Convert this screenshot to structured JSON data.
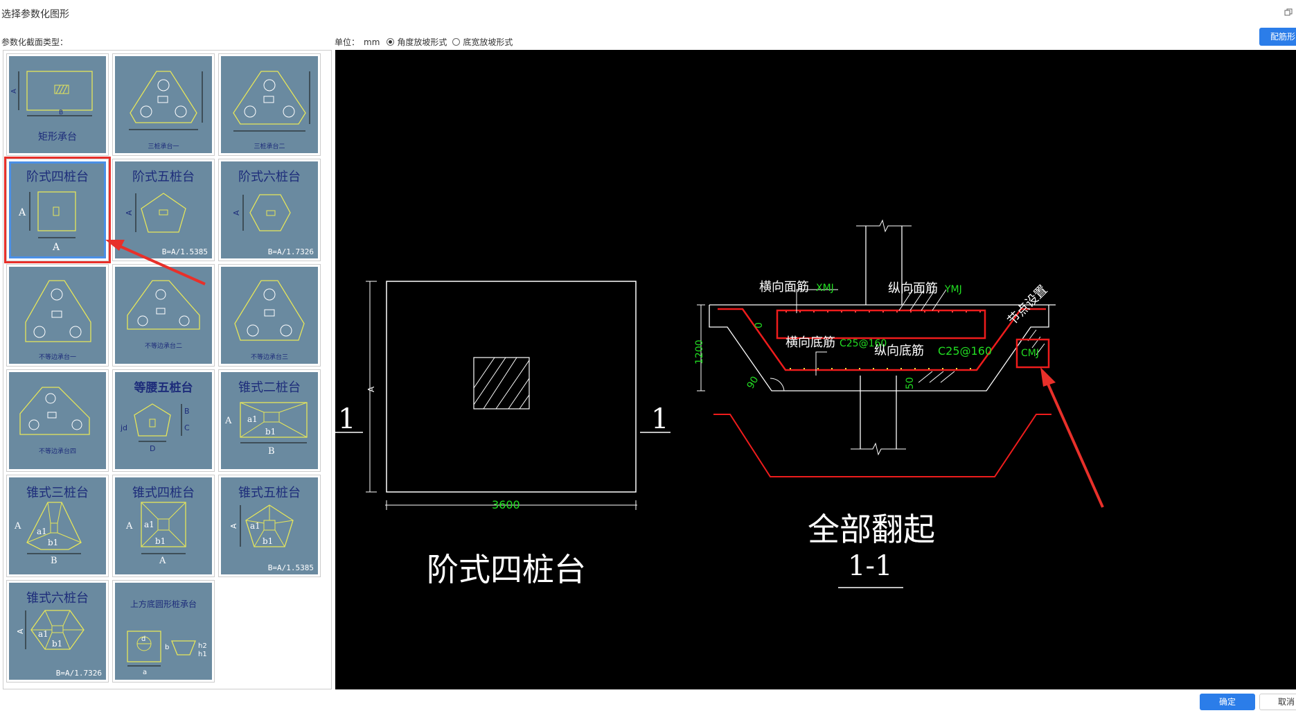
{
  "window": {
    "title": "选择参数化图形"
  },
  "toolbar": {
    "section_label": "参数化截面类型：",
    "unit_label": "单位：",
    "unit_value": "mm",
    "radio_angle": "角度放坡形式",
    "radio_width": "底宽放坡形式",
    "selected_radio": "angle",
    "rebar_button": "配筋形"
  },
  "tiles": [
    {
      "title": "矩形承台"
    },
    {
      "title": "三桩承台一"
    },
    {
      "title": "三桩承台二"
    },
    {
      "title": "阶式四桩台",
      "selected": true
    },
    {
      "title": "阶式五桩台",
      "formula": "B=A/1.5385"
    },
    {
      "title": "阶式六桩台",
      "formula": "B=A/1.7326"
    },
    {
      "title": "不等边承台一"
    },
    {
      "title": "不等边承台二"
    },
    {
      "title": "不等边承台三"
    },
    {
      "title": "不等边承台四"
    },
    {
      "title": "等腰五桩台"
    },
    {
      "title": "锥式二桩台"
    },
    {
      "title": "锥式三桩台"
    },
    {
      "title": "锥式四桩台"
    },
    {
      "title": "锥式五桩台",
      "formula": "B=A/1.5385"
    },
    {
      "title": "锥式六桩台",
      "formula": "B=A/1.7326"
    },
    {
      "title": "上方底圆形桩承台"
    }
  ],
  "tile_labels": {
    "A": "A",
    "B": "B",
    "C": "C",
    "D": "D",
    "a1": "a1",
    "b1": "b1",
    "jd": "jd",
    "d": "d",
    "b": "b",
    "a": "a",
    "h1": "h1",
    "h2": "h2"
  },
  "canvas": {
    "plan_title": "阶式四桩台",
    "dim_width": "3600",
    "section_mark": "1",
    "section_title": "全部翻起",
    "section_id": "1-1",
    "label_hor_top": "横向面筋",
    "label_hor_top_code": "XMJ",
    "label_long_top": "纵向面筋",
    "label_long_top_code": "YMJ",
    "label_hor_bot": "横向底筋",
    "label_hor_bot_code": "C25@160",
    "label_long_bot": "纵向底筋",
    "label_long_bot_code": "C25@160",
    "label_node": "节点设置",
    "label_cmj": "CMJ",
    "dim_height": "1200",
    "dim_zero": "0",
    "dim_50": "50",
    "dim_90": "90"
  },
  "colors": {
    "accent": "#2b7de9",
    "highlight": "#e8302a",
    "tile_bg": "#6a8aa0",
    "cad_green": "#22dd22",
    "cad_red": "#ee1c1c"
  },
  "footer": {
    "ok": "确定",
    "cancel": "取消"
  }
}
